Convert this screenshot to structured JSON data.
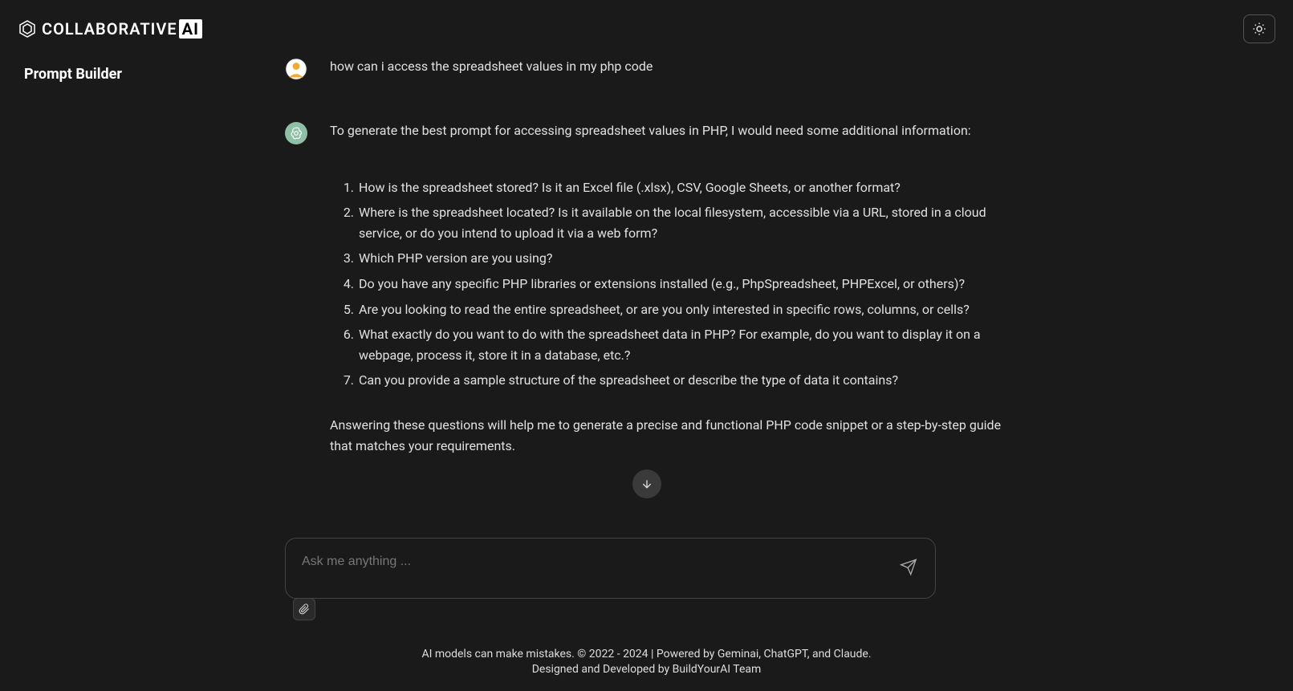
{
  "header": {
    "logo_text": "COLLABORATIVE",
    "logo_suffix": "AI"
  },
  "page": {
    "title": "Prompt Builder"
  },
  "chat": {
    "user_message": "how can i access the spreadsheet values in my php code",
    "ai_intro": "To generate the best prompt for accessing spreadsheet values in PHP, I would need some additional information:",
    "ai_questions": [
      "How is the spreadsheet stored? Is it an Excel file (.xlsx), CSV, Google Sheets, or another format?",
      "Where is the spreadsheet located? Is it available on the local filesystem, accessible via a URL, stored in a cloud service, or do you intend to upload it via a web form?",
      "Which PHP version are you using?",
      "Do you have any specific PHP libraries or extensions installed (e.g., PhpSpreadsheet, PHPExcel, or others)?",
      "Are you looking to read the entire spreadsheet, or are you only interested in specific rows, columns, or cells?",
      "What exactly do you want to do with the spreadsheet data in PHP? For example, do you want to display it on a webpage, process it, store it in a database, etc.?",
      "Can you provide a sample structure of the spreadsheet or describe the type of data it contains?"
    ],
    "ai_outro": "Answering these questions will help me to generate a precise and functional PHP code snippet or a step-by-step guide that matches your requirements."
  },
  "input": {
    "placeholder": "Ask me anything ..."
  },
  "footer": {
    "line1": "AI models can make mistakes. © 2022 - 2024 | Powered by Geminai, ChatGPT, and Claude.",
    "line2": "Designed and Developed by BuildYourAI Team"
  }
}
